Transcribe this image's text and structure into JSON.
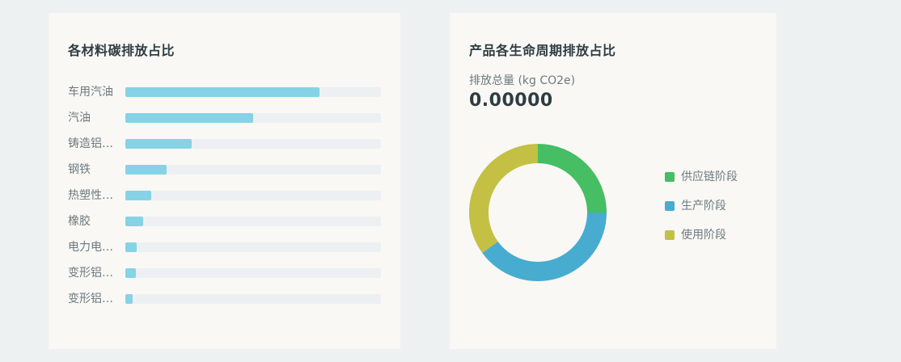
{
  "materials_panel": {
    "title": "各材料碳排放占比",
    "bar_color": "#86d3e6",
    "track_color": "#edf0f2",
    "items": [
      {
        "label": "车用汽油",
        "fraction": 0.76
      },
      {
        "label": "汽油",
        "fraction": 0.5
      },
      {
        "label": "铸造铝…",
        "fraction": 0.26
      },
      {
        "label": "钢铁",
        "fraction": 0.16
      },
      {
        "label": "热塑性…",
        "fraction": 0.1
      },
      {
        "label": "橡胶",
        "fraction": 0.07
      },
      {
        "label": "电力电…",
        "fraction": 0.045
      },
      {
        "label": "变形铝…",
        "fraction": 0.04
      },
      {
        "label": "变形铝…",
        "fraction": 0.03
      }
    ]
  },
  "lifecycle_panel": {
    "title": "产品各生命周期排放占比",
    "total_label": "排放总量 (kg CO2e)",
    "total_value": "0.00000",
    "stages": [
      {
        "label": "供应链阶段",
        "share": 0.25,
        "color": "#45be64"
      },
      {
        "label": "生产阶段",
        "share": 0.4,
        "color": "#47acd0"
      },
      {
        "label": "使用阶段",
        "share": 0.35,
        "color": "#c4c044"
      }
    ]
  }
}
